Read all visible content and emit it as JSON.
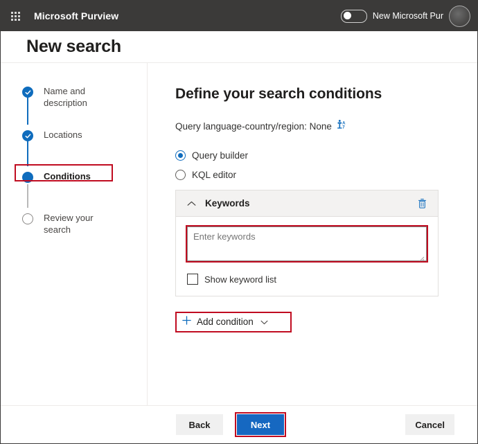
{
  "suite": {
    "waffle_icon": "waffle-grid-icon",
    "title": "Microsoft Purview",
    "toggle": {
      "label": "New Microsoft Pur",
      "state": "off",
      "icon": "toggle-switch-icon"
    },
    "avatar_icon": "user-avatar-icon"
  },
  "page": {
    "title": "New search"
  },
  "stepper": {
    "items": [
      {
        "label": "Name and description",
        "state": "completed",
        "icon": "check-circle-icon"
      },
      {
        "label": "Locations",
        "state": "completed",
        "icon": "check-circle-icon"
      },
      {
        "label": "Conditions",
        "state": "current",
        "icon": "filled-circle-icon",
        "highlighted": true
      },
      {
        "label": "Review your search",
        "state": "pending",
        "icon": "empty-circle-icon"
      }
    ]
  },
  "main": {
    "heading": "Define your search conditions",
    "query_language": {
      "text": "Query language-country/region: None",
      "icon": "translate-language-icon"
    },
    "mode_options": [
      {
        "label": "Query builder",
        "selected": true
      },
      {
        "label": "KQL editor",
        "selected": false
      }
    ],
    "condition_card": {
      "collapse_icon": "chevron-up-icon",
      "title": "Keywords",
      "delete_icon": "trash-can-icon",
      "keywords_input": {
        "value": "",
        "placeholder": "Enter keywords",
        "highlighted": true,
        "resize_handle_icon": "resize-grip-icon"
      },
      "show_keyword_list": {
        "label": "Show keyword list",
        "checked": false
      }
    },
    "add_condition": {
      "plus_icon": "plus-icon",
      "label": "Add condition",
      "caret_icon": "chevron-down-icon",
      "highlighted": true
    }
  },
  "footer": {
    "back_label": "Back",
    "next_label": "Next",
    "cancel_label": "Cancel",
    "next_highlighted": true
  },
  "colors": {
    "suite_bar": "#3b3a39",
    "accent_blue": "#0f6cbd",
    "primary_button": "#1668c1",
    "annotation_red": "#c00b20",
    "card_header": "#f3f2f1",
    "border": "#e1dfdd"
  }
}
